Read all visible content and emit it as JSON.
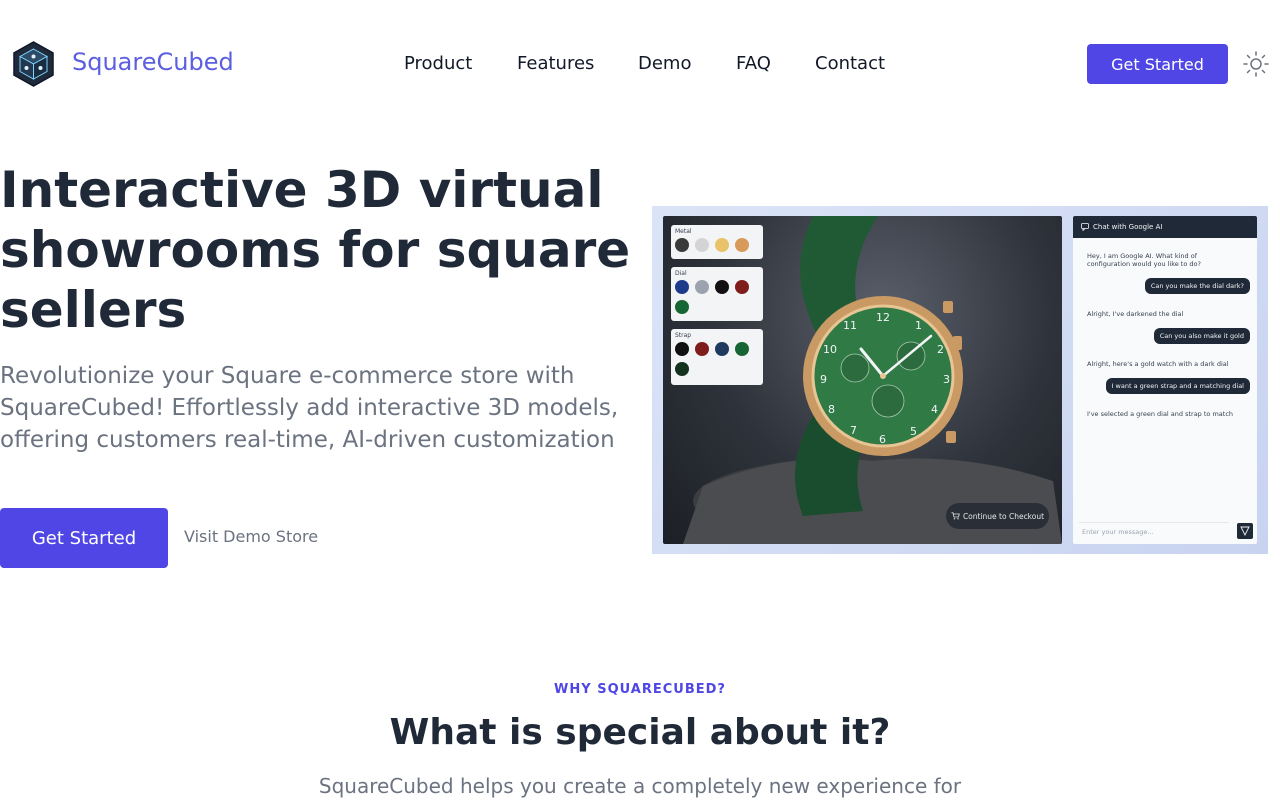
{
  "brand": {
    "name": "SquareCubed"
  },
  "nav": {
    "links": [
      "Product",
      "Features",
      "Demo",
      "FAQ",
      "Contact"
    ],
    "cta_label": "Get Started"
  },
  "hero": {
    "title": "Interactive 3D virtual showrooms for square sellers",
    "subtitle": "Revolutionize your Square e-commerce store with SquareCubed! Effortlessly add interactive 3D models, offering customers real-time, AI-driven customization",
    "primary_cta": "Get Started",
    "secondary_cta": "Visit Demo Store"
  },
  "showroom": {
    "options": [
      {
        "label": "Metal",
        "swatches": [
          "#3a3a3a",
          "#d4d4d4",
          "#e8c36a",
          "#d89a5a"
        ]
      },
      {
        "label": "Dial",
        "swatches": [
          "#1e3a8a",
          "#9ca3af",
          "#111111",
          "#7f1d1d",
          "#166534"
        ]
      },
      {
        "label": "Strap",
        "swatches": [
          "#111111",
          "#7f1d1d",
          "#1e3a5f",
          "#166534",
          "#14331f"
        ]
      }
    ],
    "checkout_label": "Continue to Checkout",
    "chat": {
      "title": "Chat with Google AI",
      "messages": [
        {
          "role": "ai",
          "text": "Hey, I am Google AI. What kind of configuration would you like to do?"
        },
        {
          "role": "user",
          "text": "Can you make the dial dark?"
        },
        {
          "role": "ai",
          "text": "Alright, I've darkened the dial"
        },
        {
          "role": "user",
          "text": "Can you also make it gold"
        },
        {
          "role": "ai",
          "text": "Alright, here's a gold watch with a dark dial"
        },
        {
          "role": "user",
          "text": "I want a green strap and a matching dial"
        },
        {
          "role": "ai",
          "text": "I've selected a green dial and strap to match"
        }
      ],
      "input_placeholder": "Enter your message..."
    }
  },
  "why": {
    "eyebrow": "WHY SQUARECUBED?",
    "title": "What is special about it?",
    "subtitle": "SquareCubed helps you create a completely new experience for"
  },
  "colors": {
    "accent": "#4f46e5",
    "brand_text": "#5b5fe0"
  }
}
